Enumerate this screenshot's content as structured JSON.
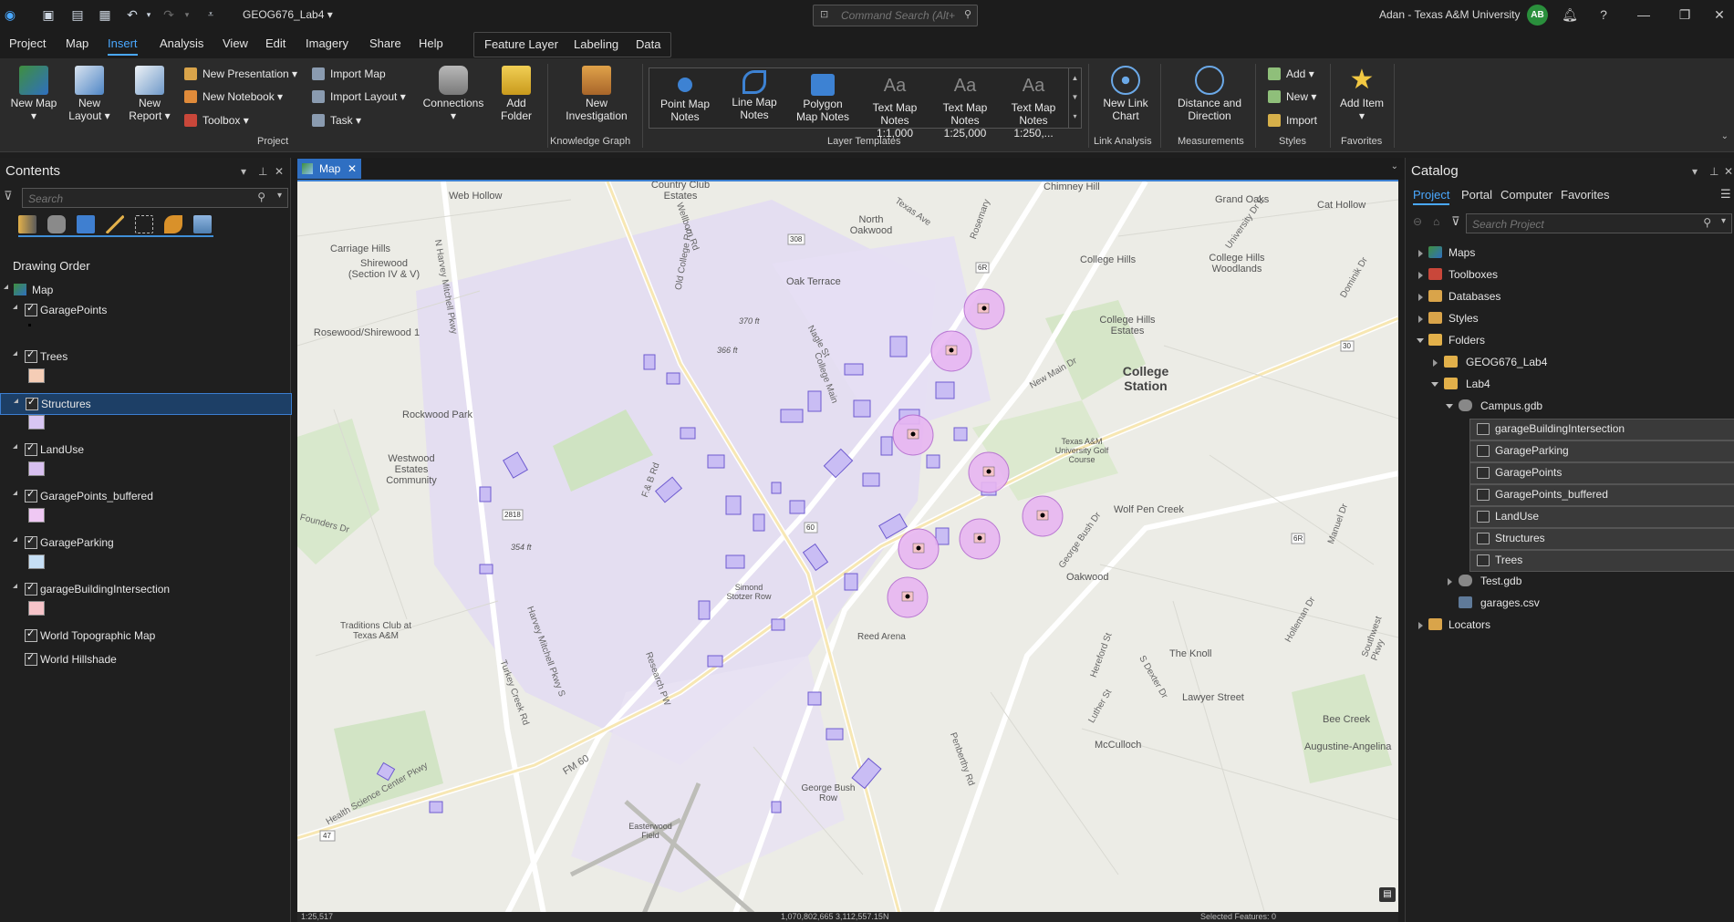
{
  "titlebar": {
    "doc_title": "GEOG676_Lab4",
    "command_search_placeholder": "Command Search (Alt+Q)",
    "user_name": "Adan - Texas A&M University",
    "user_initials": "AB"
  },
  "menu": {
    "tabs": [
      "Project",
      "Map",
      "Insert",
      "Analysis",
      "View",
      "Edit",
      "Imagery",
      "Share",
      "Help"
    ],
    "active_tab": "Insert",
    "contextual_tabs": [
      "Feature Layer",
      "Labeling",
      "Data"
    ]
  },
  "ribbon": {
    "project": {
      "new_map": "New Map",
      "new_layout": "New Layout",
      "new_report": "New Report",
      "new_presentation": "New Presentation",
      "new_notebook": "New Notebook",
      "toolbox": "Toolbox",
      "import_map": "Import Map",
      "import_layout": "Import Layout",
      "task": "Task",
      "connections": "Connections",
      "add_folder": "Add Folder",
      "label": "Project"
    },
    "knowledge_graph": {
      "new_investigation": "New Investigation",
      "label": "Knowledge Graph"
    },
    "layer_templates": {
      "items": [
        "Point Map Notes",
        "Line Map Notes",
        "Polygon Map Notes",
        "Text Map Notes 1:1,000",
        "Text Map Notes 1:25,000",
        "Text Map Notes 1:250,..."
      ],
      "label": "Layer Templates"
    },
    "link_analysis": {
      "new_link_chart": "New Link Chart",
      "label": "Link Analysis"
    },
    "measurements": {
      "distance_direction": "Distance and Direction",
      "label": "Measurements"
    },
    "styles": {
      "add": "Add",
      "new": "New",
      "import": "Import",
      "label": "Styles"
    },
    "favorites": {
      "add_item": "Add Item",
      "label": "Favorites"
    }
  },
  "contents": {
    "title": "Contents",
    "search_placeholder": "Search",
    "drawing_order": "Drawing Order",
    "map_name": "Map",
    "layers": [
      {
        "name": "GaragePoints",
        "swatch": "#000000"
      },
      {
        "name": "Trees",
        "swatch": "#f5cdb6"
      },
      {
        "name": "Structures",
        "swatch": "#d8c6f3"
      },
      {
        "name": "LandUse",
        "swatch": "#d8c0f0"
      },
      {
        "name": "GaragePoints_buffered",
        "swatch": "#efc8f3"
      },
      {
        "name": "GarageParking",
        "swatch": "#c6dff5"
      },
      {
        "name": "garageBuildingIntersection",
        "swatch": "#f6c4c9"
      },
      {
        "name": "World Topographic Map",
        "swatch": ""
      },
      {
        "name": "World Hillshade",
        "swatch": ""
      }
    ],
    "selected_layer": "Structures"
  },
  "map_tab": {
    "label": "Map"
  },
  "map_labels": {
    "places": [
      "Country Club Estates",
      "Web Hollow",
      "Chimney Hill",
      "Grand Oaks",
      "Cat Hollow",
      "North Oakwood",
      "College Hills",
      "College Hills Woodlands",
      "Carriage Hills",
      "Shirewood (Section IV & V)",
      "Oak Terrace",
      "College Hills Estates",
      "College Station",
      "Rosewood/Shirewood 1",
      "Rockwood Park",
      "Westwood Estates Community",
      "Texas A&M University Golf Course",
      "Wolf Pen Creek",
      "Oakwood",
      "Traditions Club at Texas A&M",
      "The Knoll",
      "Lawyer Street",
      "Bee Creek",
      "McCulloch",
      "Augustine-Angelina",
      "Reed Arena",
      "George Bush Row",
      "Easterwood Field",
      "Simond Stotzer Row"
    ],
    "roads": [
      "Wellborn Rd",
      "N Harvey Mitchell Pkwy",
      "Old College Rd",
      "Texas Ave",
      "University Dr E",
      "Harvey Mitchell Pkwy S",
      "Research PW",
      "FM 60",
      "Health Science Center Pkwy",
      "George Bush Dr",
      "Turkey Creek Rd",
      "Luther St",
      "Holleman Dr",
      "Manuel Dr",
      "Southwest Pkwy",
      "Penberthy Rd",
      "Dominik Dr",
      "Rosemary",
      "Nagle St",
      "College Main",
      "New Main Dr",
      "F.& B Rd",
      "Hereford St",
      "S Dexter Dr",
      "Founders Dr"
    ],
    "shields": [
      "308",
      "6R",
      "30",
      "2818",
      "60",
      "47",
      "6R"
    ],
    "elevations": [
      "370 ft",
      "366 ft",
      "354 ft"
    ]
  },
  "status": {
    "scale": "1:25,517",
    "coords": "1,070,802,665 3,112,557.15N",
    "selected": "Selected Features: 0"
  },
  "catalog": {
    "title": "Catalog",
    "tabs": [
      "Project",
      "Portal",
      "Computer",
      "Favorites"
    ],
    "active_tab": "Project",
    "search_placeholder": "Search Project",
    "tree": {
      "maps": "Maps",
      "toolboxes": "Toolboxes",
      "databases": "Databases",
      "styles": "Styles",
      "folders": "Folders",
      "geog_folder": "GEOG676_Lab4",
      "lab4": "Lab4",
      "campus_gdb": "Campus.gdb",
      "feature_classes": [
        "garageBuildingIntersection",
        "GarageParking",
        "GaragePoints",
        "GaragePoints_buffered",
        "LandUse",
        "Structures",
        "Trees"
      ],
      "test_gdb": "Test.gdb",
      "garages_csv": "garages.csv",
      "locators": "Locators"
    }
  },
  "colors": {
    "accent": "#4aa8ff",
    "buffer_fill": "#e8b6f2",
    "structure_fill": "#c9bdf4",
    "landuse_fill": "#e3dcf2",
    "selected_row": "#1d3f66"
  }
}
